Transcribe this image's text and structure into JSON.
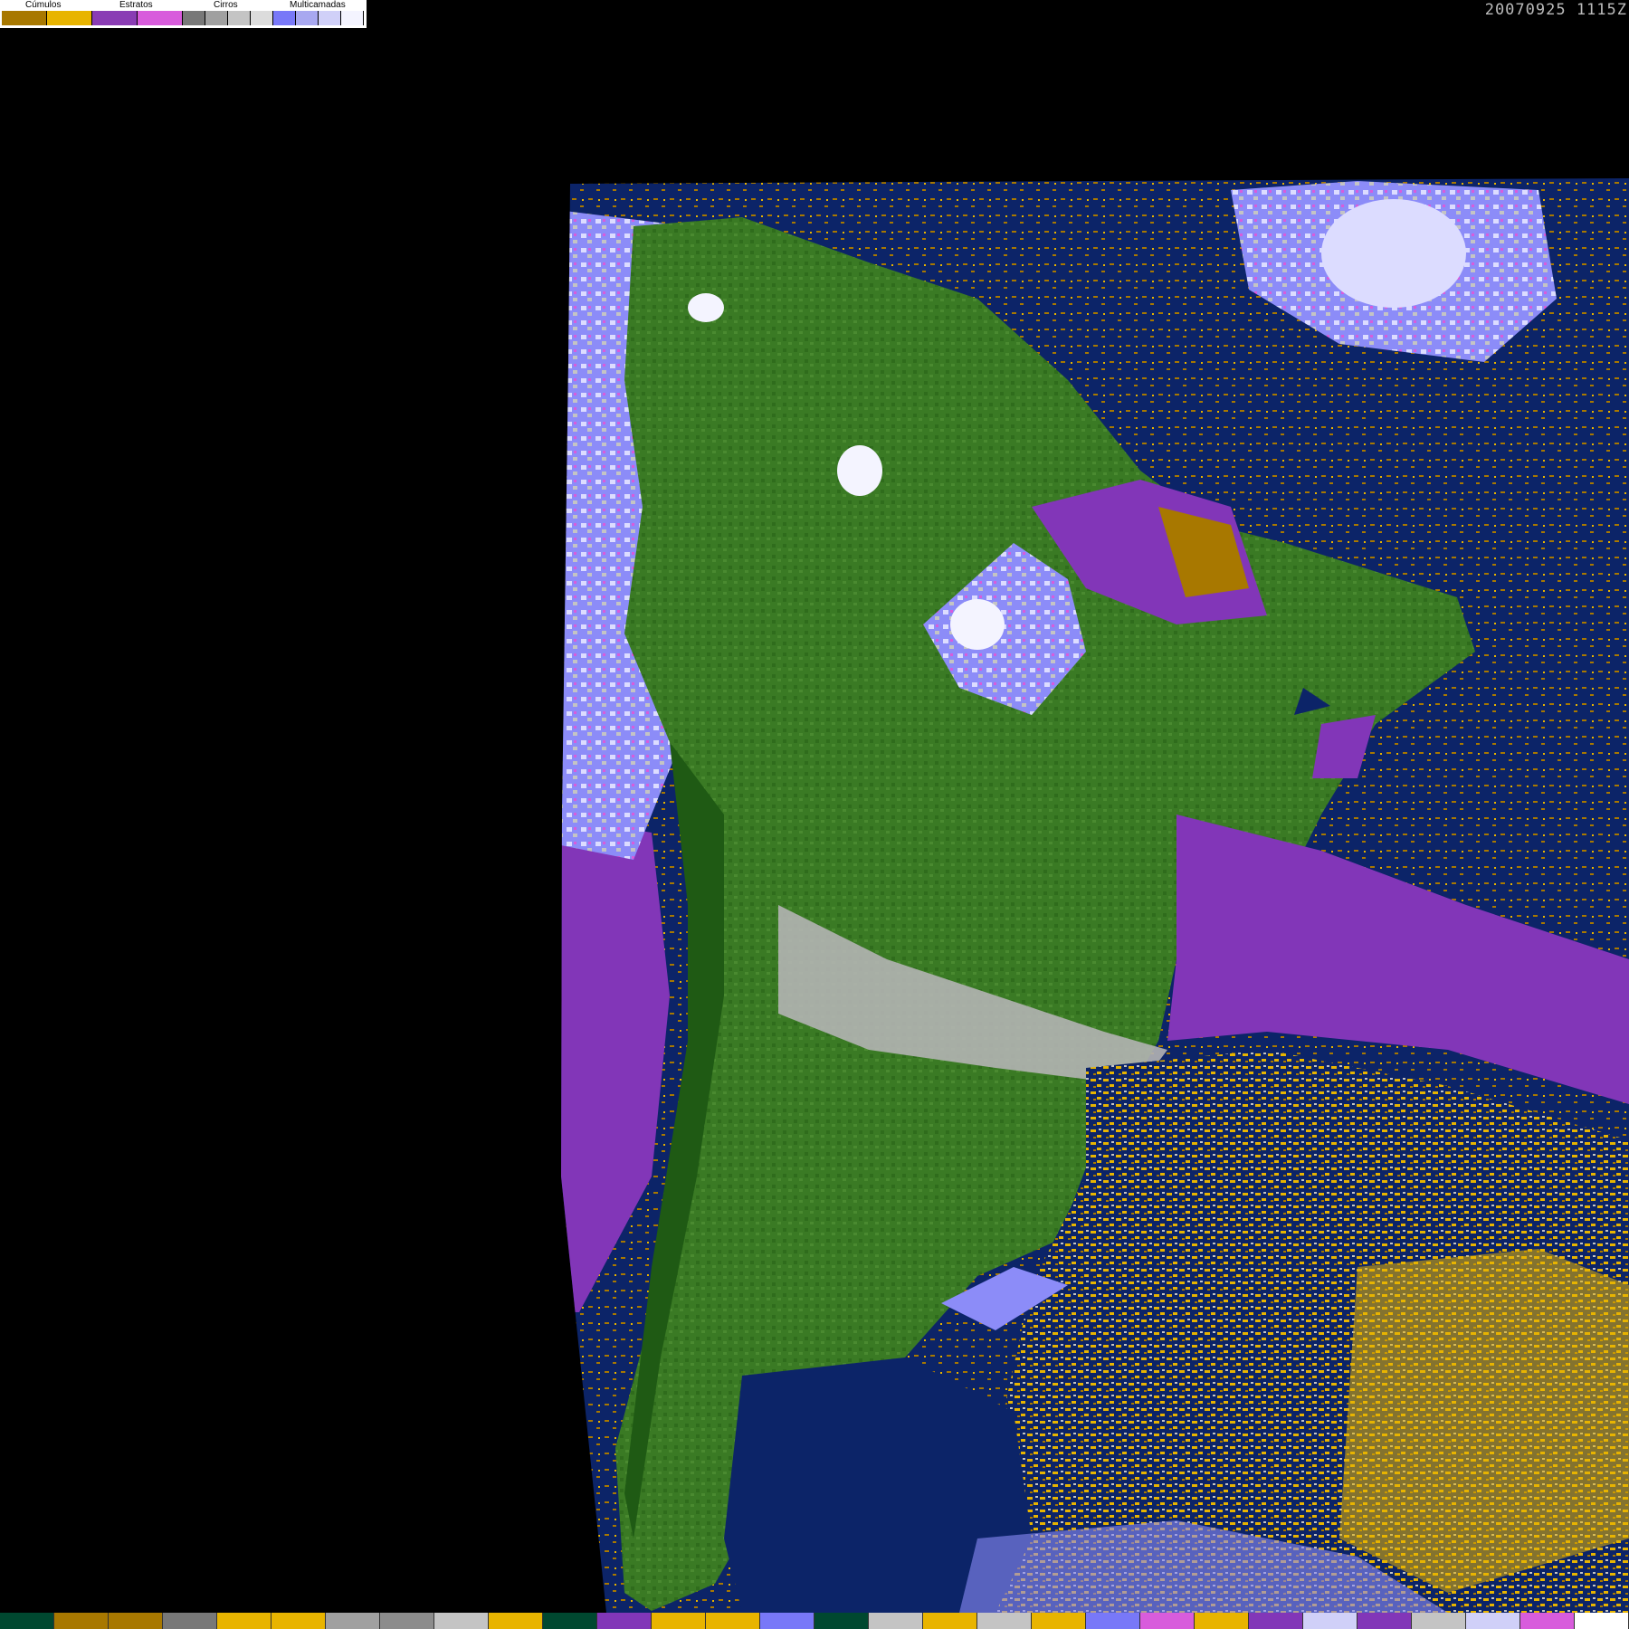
{
  "legend": {
    "labels": {
      "cumulos": "Cúmulos",
      "estratos": "Estratos",
      "cirros": "Cirros",
      "multicamadas": "Multicamadas"
    },
    "colors": {
      "cumulos": [
        "#a87800",
        "#e8b400"
      ],
      "estratos": [
        "#8a3cb4",
        "#d85cdc"
      ],
      "cirros": [
        "#787878",
        "#a0a0a0",
        "#c4c4c4",
        "#dcdcdc"
      ],
      "multicamadas": [
        "#7878f8",
        "#a8a8f0",
        "#d0d0f8",
        "#f4f4ff"
      ]
    }
  },
  "timestamp": "20070925 1115Z",
  "palette": {
    "space": "#000000",
    "ocean": "#0c2468",
    "land_dark": "#1f5a14",
    "land": "#3a7a24",
    "land_light": "#568c32",
    "cumulus_low": "#a87800",
    "cumulus_mid": "#e8b400",
    "stratus": "#8236b8",
    "stratus_pink": "#d85cdc",
    "cirrus": "#b4b4b4",
    "multilayer": "#8c8cf8",
    "multilayer_light": "#dcdcff"
  },
  "bottom_bar": [
    "#004830",
    "#a87800",
    "#a87800",
    "#787878",
    "#e8b400",
    "#e8b400",
    "#a0a0a0",
    "#8c8c8c",
    "#c4c4c4",
    "#e8b400",
    "#004830",
    "#8236b8",
    "#e8b400",
    "#e8b400",
    "#7878f8",
    "#004830",
    "#c4c4c4",
    "#e8b400",
    "#c4c4c4",
    "#e8b400",
    "#7878f8",
    "#d85cdc",
    "#e8b400",
    "#8236b8",
    "#d0d0f8",
    "#8236b8",
    "#c4c4c4",
    "#d0d0f8",
    "#d85cdc",
    "#ffffff"
  ]
}
